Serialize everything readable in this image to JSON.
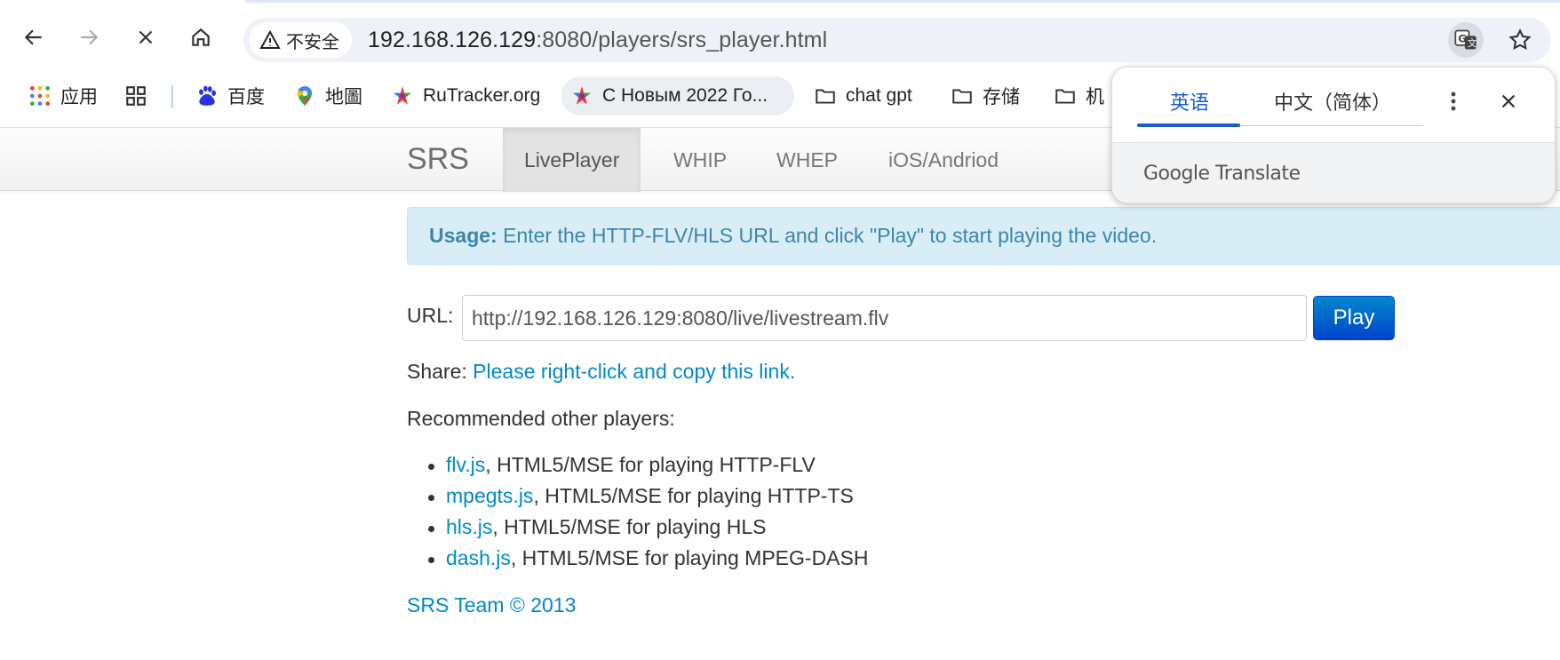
{
  "browser": {
    "security_label": "不安全",
    "url_host": "192.168.126.129",
    "url_rest": ":8080/players/srs_player.html"
  },
  "bookmarks": {
    "apps": "应用",
    "baidu": "百度",
    "maps": "地圖",
    "rutracker": "RuTracker.org",
    "newyear": "С Новым 2022 Го...",
    "chatgpt": "chat gpt",
    "storage": "存储",
    "folder3": "机"
  },
  "srs_nav": {
    "brand": "SRS",
    "tabs": [
      "LivePlayer",
      "WHIP",
      "WHEP",
      "iOS/Andriod"
    ]
  },
  "main": {
    "usage_label": "Usage:",
    "usage_text": " Enter the HTTP-FLV/HLS URL and click \"Play\" to start playing the video.",
    "url_label": "URL:",
    "url_value": "http://192.168.126.129:8080/live/livestream.flv",
    "play_label": "Play",
    "share_label": "Share: ",
    "share_link": "Please right-click and copy this link.",
    "recommended": "Recommended other players:",
    "players": [
      {
        "name": "flv.js",
        "desc": ", HTML5/MSE for playing HTTP-FLV"
      },
      {
        "name": "mpegts.js",
        "desc": ", HTML5/MSE for playing HTTP-TS"
      },
      {
        "name": "hls.js",
        "desc": ", HTML5/MSE for playing HLS"
      },
      {
        "name": "dash.js",
        "desc": ", HTML5/MSE for playing MPEG-DASH"
      }
    ],
    "footer": "SRS Team © 2013"
  },
  "translate_popup": {
    "tab_source": "英语",
    "tab_target": "中文（简体）",
    "brand_google": "Google",
    "brand_translate": " Translate"
  },
  "colors": {
    "link": "#0088cc",
    "usage_bg": "#d9edf7",
    "play_button": "#0055cc",
    "translate_accent": "#1a5dd0"
  }
}
